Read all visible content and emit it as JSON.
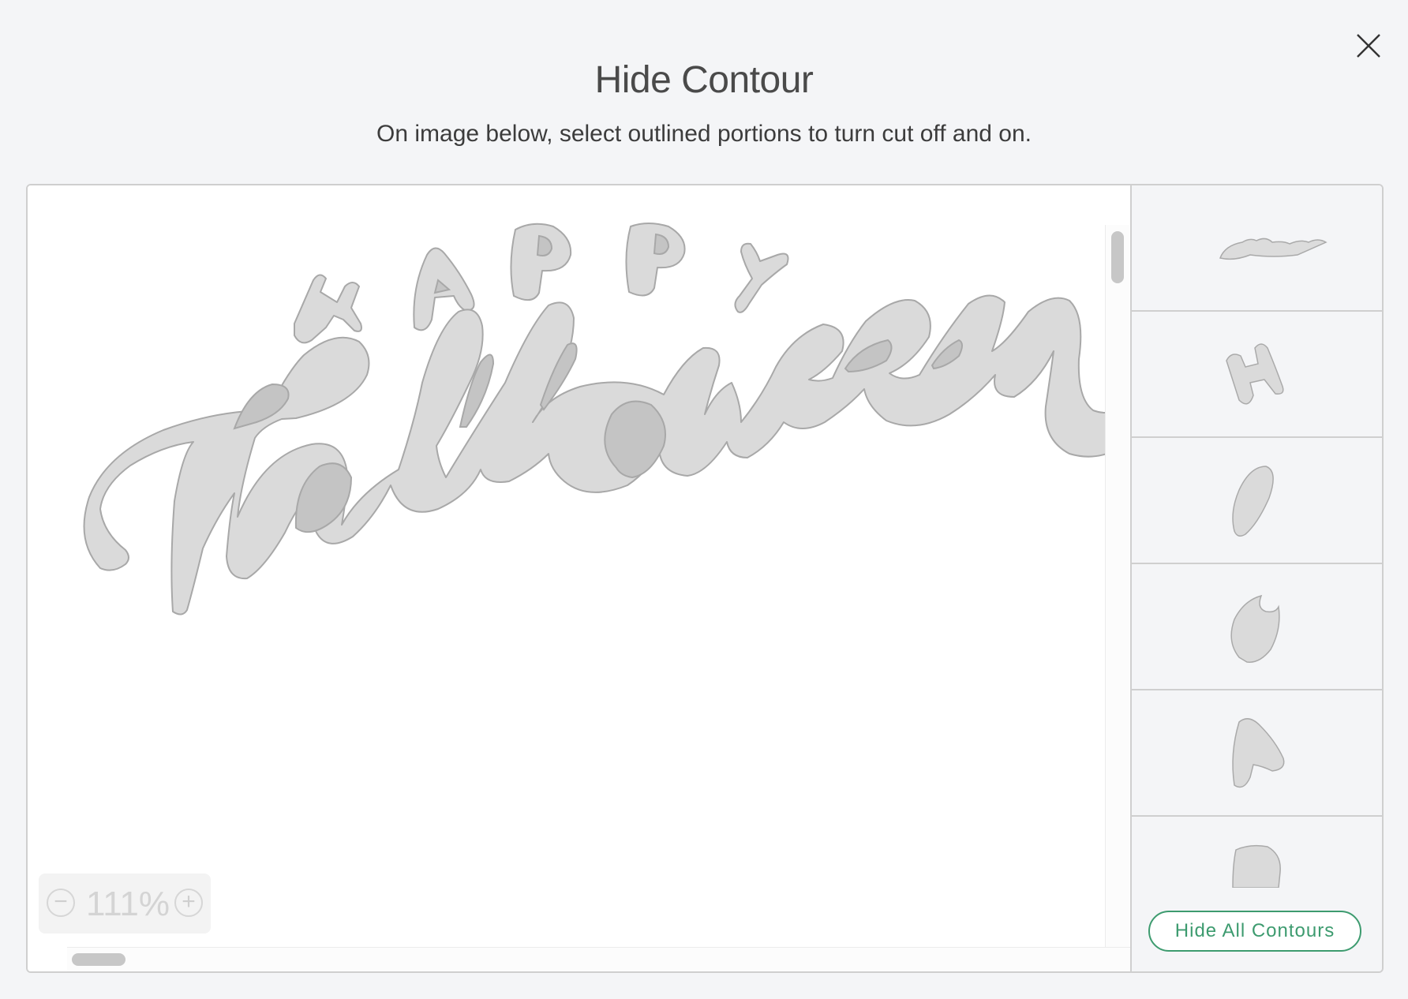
{
  "dialog": {
    "title": "Hide Contour",
    "instructions": "On image below, select outlined portions to turn cut off and on.",
    "close_icon": "close-icon"
  },
  "canvas": {
    "artwork": "Happy Halloween",
    "zoom": {
      "value": "111%",
      "minus_icon": "minus-circle-icon",
      "plus_icon": "plus-circle-icon"
    }
  },
  "contours": {
    "items": [
      {
        "name": "halloween-word"
      },
      {
        "name": "letter-h"
      },
      {
        "name": "inner-oval"
      },
      {
        "name": "inner-o-shape"
      },
      {
        "name": "letter-a"
      },
      {
        "name": "letter-p"
      }
    ],
    "hide_all_label": "Hide All Contours"
  },
  "colors": {
    "accent": "#3d9b6f",
    "shape_fill": "#dadada",
    "shape_stroke": "#a8a8a8",
    "hole_fill": "#c4c4c4"
  }
}
